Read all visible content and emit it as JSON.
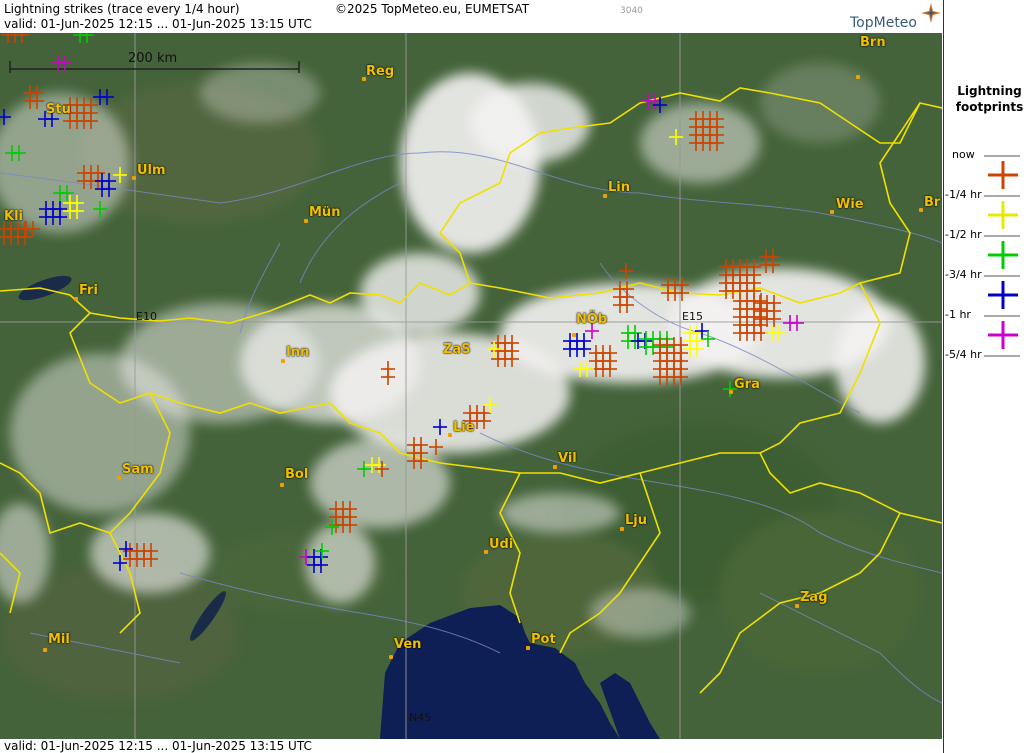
{
  "header": {
    "title": "Lightning strikes (trace every 1/4 hour)",
    "copyright": "©2025 TopMeteo.eu, EUMETSAT",
    "code": "3040",
    "valid": "valid:  01-Jun-2025 12:15 ... 01-Jun-2025 13:15 UTC",
    "logo": "TopMeteo"
  },
  "footer": {
    "valid": "valid:  01-Jun-2025 12:15 ... 01-Jun-2025 13:15 UTC"
  },
  "scale": {
    "label": "200 km"
  },
  "grid_labels": {
    "e10": "E10",
    "e15": "E15",
    "n45": "N45"
  },
  "cities": [
    "Brn",
    "Reg",
    "Stu",
    "Ulm",
    "Lin",
    "Mün",
    "Kli",
    "Wie",
    "Br",
    "Fri",
    "NÖb",
    "Inn",
    "ZaS",
    "Gra",
    "Lie",
    "Vil",
    "Sam",
    "Bol",
    "Lju",
    "Udi",
    "Zag",
    "Mil",
    "Ven",
    "Pot"
  ],
  "legend": {
    "title_line1": "Lightning",
    "title_line2": "footprints",
    "items": [
      {
        "label": "now",
        "color": "#cc4400"
      },
      {
        "label": "-1/4 hr",
        "color": "#ffff00"
      },
      {
        "label": "-1/2 hr",
        "color": "#00cc00"
      },
      {
        "label": "-3/4 hr",
        "color": "#0000cc"
      },
      {
        "label": "-1 hr",
        "color": "#cc00cc"
      },
      {
        "label": "-5/4 hr",
        "color": ""
      }
    ]
  },
  "colors": {
    "border": "#f0e000",
    "sea": "#0d1f55",
    "land": "#42603a",
    "cloud": "#f4f2f2"
  }
}
